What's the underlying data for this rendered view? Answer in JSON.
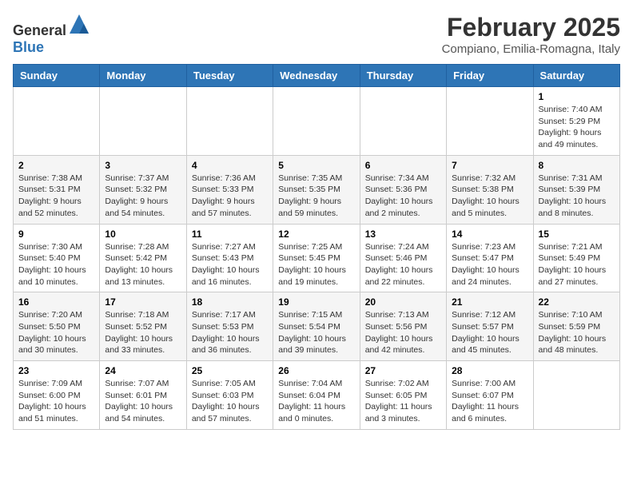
{
  "header": {
    "logo_general": "General",
    "logo_blue": "Blue",
    "title": "February 2025",
    "subtitle": "Compiano, Emilia-Romagna, Italy"
  },
  "weekdays": [
    "Sunday",
    "Monday",
    "Tuesday",
    "Wednesday",
    "Thursday",
    "Friday",
    "Saturday"
  ],
  "weeks": [
    [
      {
        "day": "",
        "info": ""
      },
      {
        "day": "",
        "info": ""
      },
      {
        "day": "",
        "info": ""
      },
      {
        "day": "",
        "info": ""
      },
      {
        "day": "",
        "info": ""
      },
      {
        "day": "",
        "info": ""
      },
      {
        "day": "1",
        "info": "Sunrise: 7:40 AM\nSunset: 5:29 PM\nDaylight: 9 hours and 49 minutes."
      }
    ],
    [
      {
        "day": "2",
        "info": "Sunrise: 7:38 AM\nSunset: 5:31 PM\nDaylight: 9 hours and 52 minutes."
      },
      {
        "day": "3",
        "info": "Sunrise: 7:37 AM\nSunset: 5:32 PM\nDaylight: 9 hours and 54 minutes."
      },
      {
        "day": "4",
        "info": "Sunrise: 7:36 AM\nSunset: 5:33 PM\nDaylight: 9 hours and 57 minutes."
      },
      {
        "day": "5",
        "info": "Sunrise: 7:35 AM\nSunset: 5:35 PM\nDaylight: 9 hours and 59 minutes."
      },
      {
        "day": "6",
        "info": "Sunrise: 7:34 AM\nSunset: 5:36 PM\nDaylight: 10 hours and 2 minutes."
      },
      {
        "day": "7",
        "info": "Sunrise: 7:32 AM\nSunset: 5:38 PM\nDaylight: 10 hours and 5 minutes."
      },
      {
        "day": "8",
        "info": "Sunrise: 7:31 AM\nSunset: 5:39 PM\nDaylight: 10 hours and 8 minutes."
      }
    ],
    [
      {
        "day": "9",
        "info": "Sunrise: 7:30 AM\nSunset: 5:40 PM\nDaylight: 10 hours and 10 minutes."
      },
      {
        "day": "10",
        "info": "Sunrise: 7:28 AM\nSunset: 5:42 PM\nDaylight: 10 hours and 13 minutes."
      },
      {
        "day": "11",
        "info": "Sunrise: 7:27 AM\nSunset: 5:43 PM\nDaylight: 10 hours and 16 minutes."
      },
      {
        "day": "12",
        "info": "Sunrise: 7:25 AM\nSunset: 5:45 PM\nDaylight: 10 hours and 19 minutes."
      },
      {
        "day": "13",
        "info": "Sunrise: 7:24 AM\nSunset: 5:46 PM\nDaylight: 10 hours and 22 minutes."
      },
      {
        "day": "14",
        "info": "Sunrise: 7:23 AM\nSunset: 5:47 PM\nDaylight: 10 hours and 24 minutes."
      },
      {
        "day": "15",
        "info": "Sunrise: 7:21 AM\nSunset: 5:49 PM\nDaylight: 10 hours and 27 minutes."
      }
    ],
    [
      {
        "day": "16",
        "info": "Sunrise: 7:20 AM\nSunset: 5:50 PM\nDaylight: 10 hours and 30 minutes."
      },
      {
        "day": "17",
        "info": "Sunrise: 7:18 AM\nSunset: 5:52 PM\nDaylight: 10 hours and 33 minutes."
      },
      {
        "day": "18",
        "info": "Sunrise: 7:17 AM\nSunset: 5:53 PM\nDaylight: 10 hours and 36 minutes."
      },
      {
        "day": "19",
        "info": "Sunrise: 7:15 AM\nSunset: 5:54 PM\nDaylight: 10 hours and 39 minutes."
      },
      {
        "day": "20",
        "info": "Sunrise: 7:13 AM\nSunset: 5:56 PM\nDaylight: 10 hours and 42 minutes."
      },
      {
        "day": "21",
        "info": "Sunrise: 7:12 AM\nSunset: 5:57 PM\nDaylight: 10 hours and 45 minutes."
      },
      {
        "day": "22",
        "info": "Sunrise: 7:10 AM\nSunset: 5:59 PM\nDaylight: 10 hours and 48 minutes."
      }
    ],
    [
      {
        "day": "23",
        "info": "Sunrise: 7:09 AM\nSunset: 6:00 PM\nDaylight: 10 hours and 51 minutes."
      },
      {
        "day": "24",
        "info": "Sunrise: 7:07 AM\nSunset: 6:01 PM\nDaylight: 10 hours and 54 minutes."
      },
      {
        "day": "25",
        "info": "Sunrise: 7:05 AM\nSunset: 6:03 PM\nDaylight: 10 hours and 57 minutes."
      },
      {
        "day": "26",
        "info": "Sunrise: 7:04 AM\nSunset: 6:04 PM\nDaylight: 11 hours and 0 minutes."
      },
      {
        "day": "27",
        "info": "Sunrise: 7:02 AM\nSunset: 6:05 PM\nDaylight: 11 hours and 3 minutes."
      },
      {
        "day": "28",
        "info": "Sunrise: 7:00 AM\nSunset: 6:07 PM\nDaylight: 11 hours and 6 minutes."
      },
      {
        "day": "",
        "info": ""
      }
    ]
  ]
}
